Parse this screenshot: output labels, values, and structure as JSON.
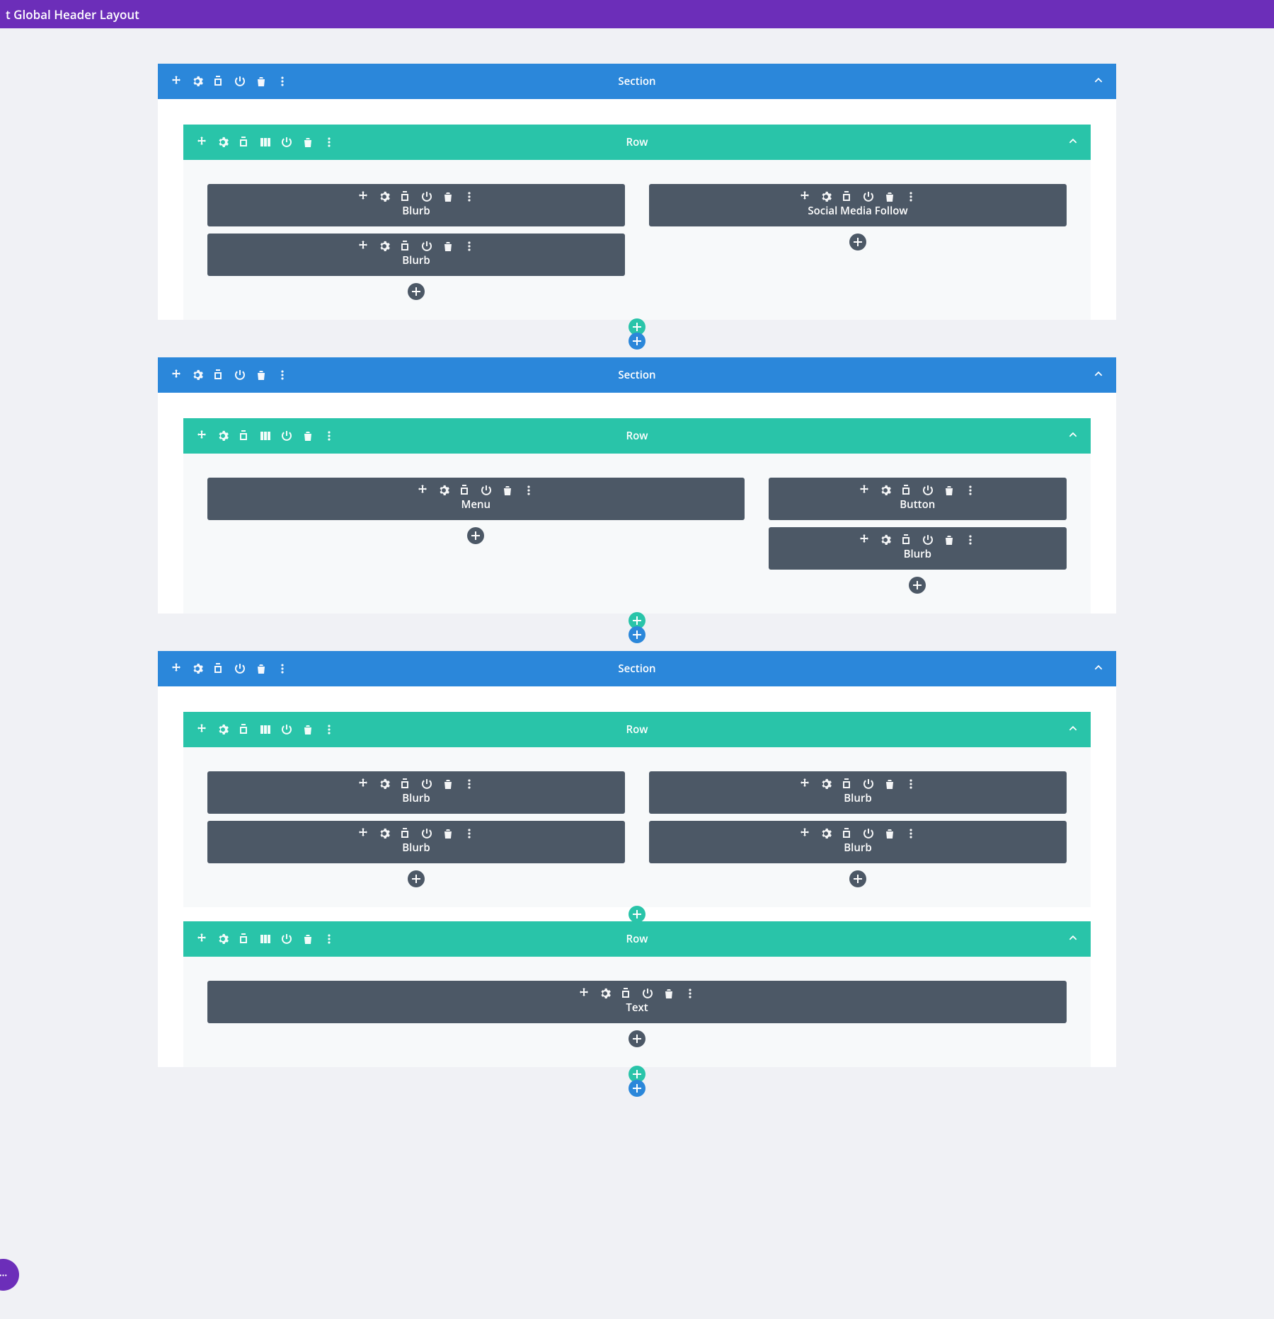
{
  "topbar": {
    "title": "t Global Header Layout"
  },
  "labels": {
    "section": "Section",
    "row": "Row"
  },
  "sections": [
    {
      "rows": [
        {
          "cols": [
            {
              "modules": [
                "Blurb",
                "Blurb"
              ]
            },
            {
              "modules": [
                "Social Media Follow"
              ]
            }
          ]
        }
      ]
    },
    {
      "rows": [
        {
          "layout": "wide-narrow",
          "cols": [
            {
              "modules": [
                "Menu"
              ]
            },
            {
              "modules": [
                "Button",
                "Blurb"
              ]
            }
          ]
        }
      ]
    },
    {
      "rows": [
        {
          "cols": [
            {
              "modules": [
                "Blurb",
                "Blurb"
              ]
            },
            {
              "modules": [
                "Blurb",
                "Blurb"
              ]
            }
          ]
        },
        {
          "cols": [
            {
              "modules": [
                "Text"
              ]
            }
          ]
        }
      ]
    }
  ],
  "fab": "•••"
}
